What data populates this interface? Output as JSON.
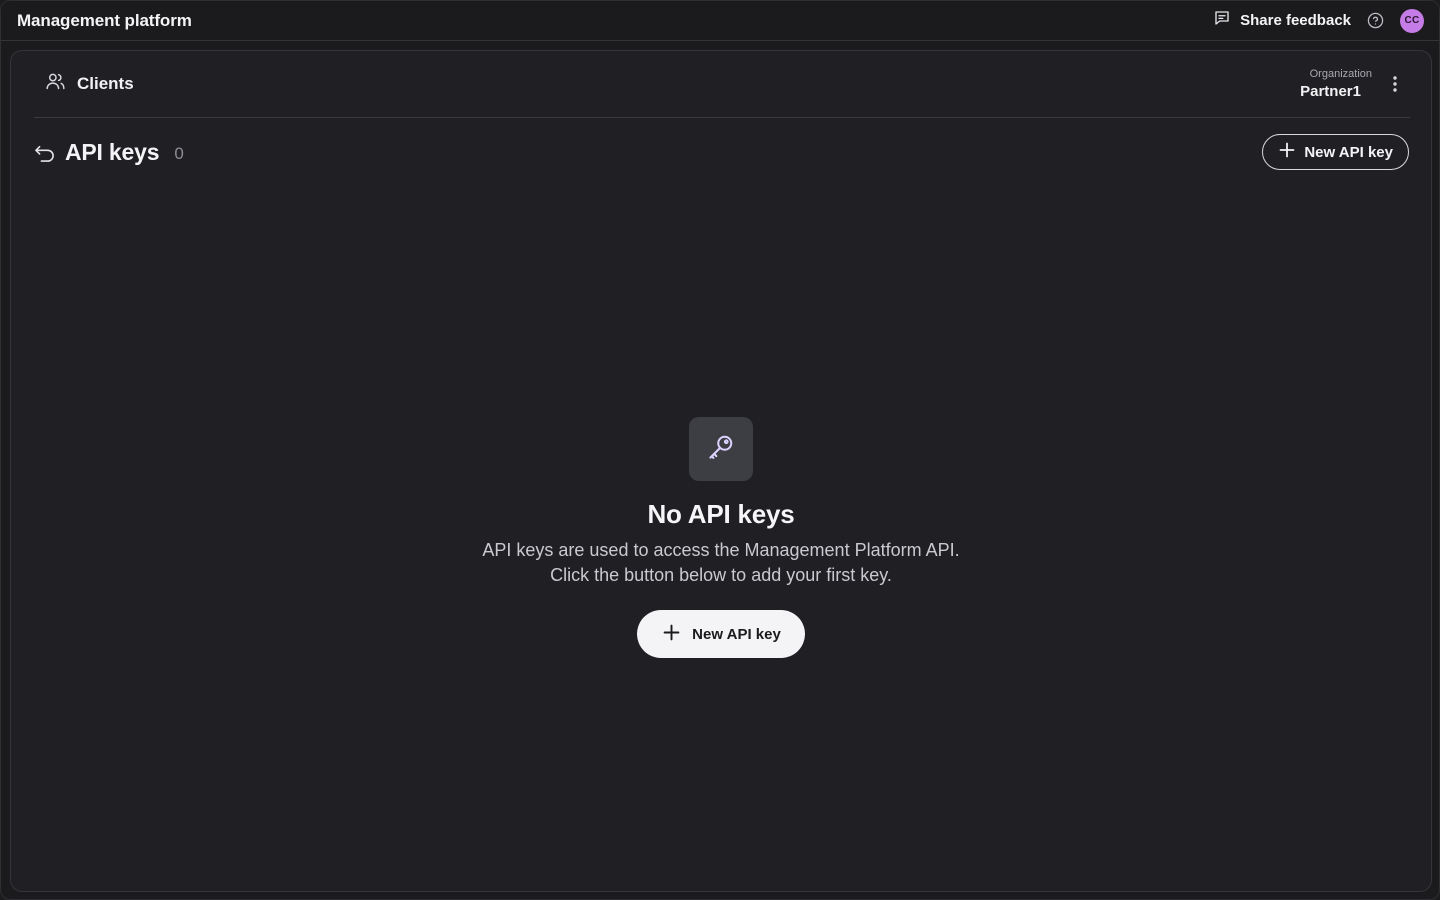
{
  "topbar": {
    "title": "Management platform",
    "feedback_label": "Share feedback",
    "feedback_icon": "message-square-icon",
    "help_icon": "help-circle-icon",
    "avatar_initials": "CC",
    "avatar_color": "#c57ce6"
  },
  "panel": {
    "breadcrumb": {
      "label": "Clients",
      "icon": "users-icon"
    },
    "organization": {
      "caption": "Organization",
      "name": "Partner1",
      "menu_icon": "more-vertical-icon"
    }
  },
  "page": {
    "back_icon": "undo-arrow-icon",
    "title": "API keys",
    "count": "0",
    "new_button_label": "New API key",
    "new_button_icon": "plus-icon"
  },
  "empty_state": {
    "icon": "key-icon",
    "title": "No API keys",
    "description": "API keys are used to access the Management Platform API. Click the button below to add your first key.",
    "button_label": "New API key",
    "button_icon": "plus-icon"
  },
  "colors": {
    "background": "#1b1b1e",
    "panel": "#202024",
    "primary_button": "#f4f4f6",
    "key_icon_stroke": "#c9b7ff"
  }
}
